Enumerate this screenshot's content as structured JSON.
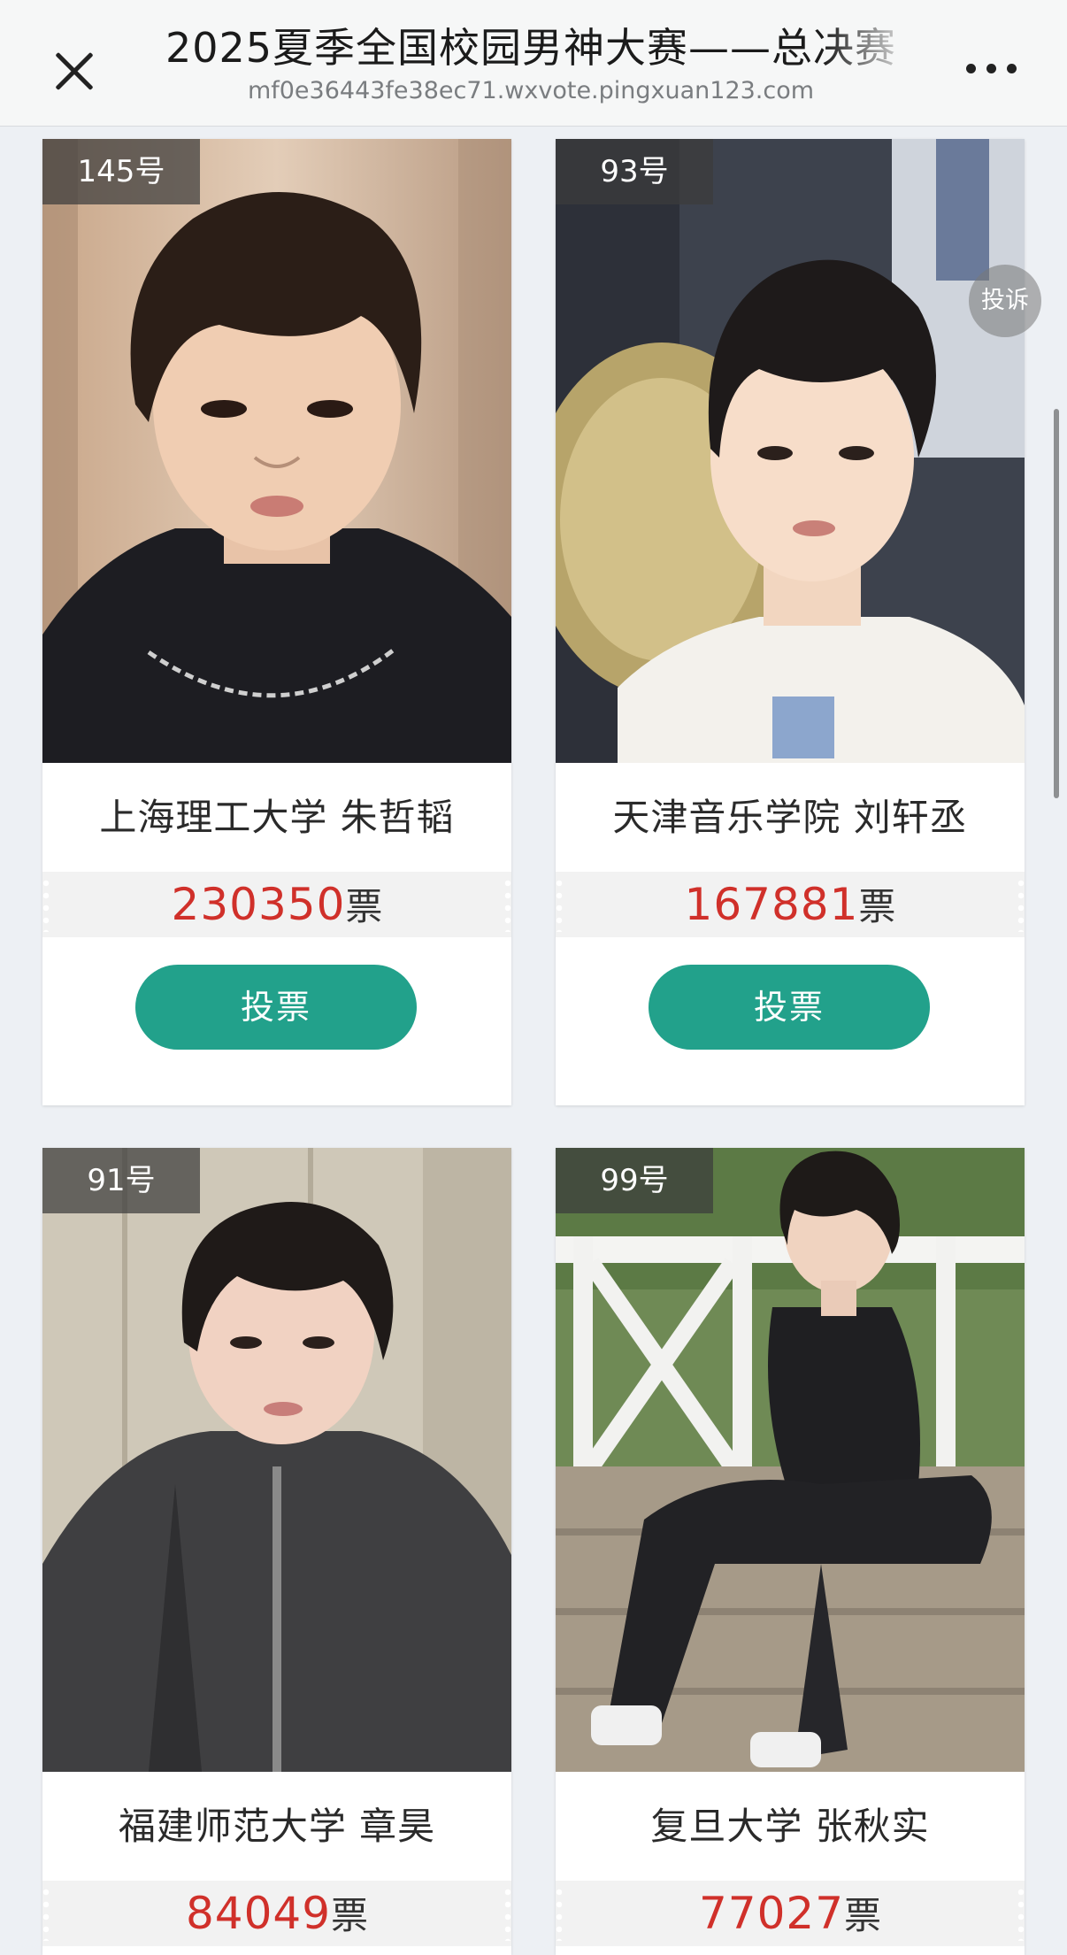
{
  "header": {
    "title": "2025夏季全国校园男神大赛——总决赛",
    "url": "mf0e36443fe38ec71.wxvote.pingxuan123.com"
  },
  "contestants": [
    {
      "number": "145号",
      "name": "上海理工大学 朱哲韬",
      "votes": "230350",
      "unit": "票",
      "button": "投票"
    },
    {
      "number": "93号",
      "name": "天津音乐学院 刘轩丞",
      "votes": "167881",
      "unit": "票",
      "button": "投票"
    },
    {
      "number": "91号",
      "name": "福建师范大学 章昊",
      "votes": "84049",
      "unit": "票"
    },
    {
      "number": "99号",
      "name": "复旦大学 张秋实",
      "votes": "77027",
      "unit": "票"
    }
  ],
  "complain_label": "投诉",
  "colors": {
    "accent": "#22a18b",
    "vote_count": "#d0302a",
    "background": "#edf0f4"
  },
  "icons": [
    "close-icon",
    "more-icon"
  ]
}
